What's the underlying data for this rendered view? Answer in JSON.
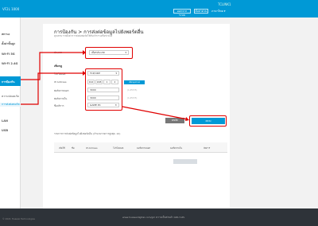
{
  "topbar": {
    "model": "VF2L 1000",
    "name": "TCLINK1",
    "btn_logout": "ออกจากระบบ",
    "btn_setup": "ตั้งค่าด่วน",
    "lang": "ภาษาไทย ▾"
  },
  "sidebar": {
    "items": [
      "สถานะ",
      "ตั้งค่าขั้นสูง",
      "Wi-Fi 5G",
      "Wi-Fi 2.4G",
      "การป้องกัน",
      "ความปลอดภัย",
      "การส่งต่อพอร์ต",
      "LAN",
      "USB"
    ],
    "active_sub": "การส่งต่อพอร์ต"
  },
  "page": {
    "title": "การป้องกัน > การส่งต่อข้อมูลไปยังพอร์ตอื่น",
    "subtitle": "คุณสามารถตั้งค่าการส่งต่อพอร์ตให้กับบริการเครือข่ายได้"
  },
  "form": {
    "type_label": "ประเภท",
    "type_value": "เลือกประเภท",
    "rule_title": "เพิ่มกฎ",
    "protocol_label": "โปรโตคอล",
    "protocol_value": "TCP/UDP",
    "ip_label": "IP Address",
    "ip_parts": [
      "192",
      "168",
      "1",
      "2"
    ],
    "ip_badge": "เลือกอุปกรณ์",
    "ext_port_label": "พอร์ตภายนอก",
    "ext_port_value": "3000",
    "ext_port_hint": "(1-65535)",
    "int_port_label": "พอร์ตภายใน",
    "int_port_value": "3000",
    "int_port_hint": "(1-65535)",
    "app_label": "ชื่อบริการ",
    "app_value": "GAME PC",
    "cancel": "ยกเลิก",
    "ok": "ตกลง"
  },
  "list": {
    "title": "รายการการส่งต่อข้อมูลไปยังพอร์ตอื่น (จำนวนรายการสูงสุด: 10)",
    "headers": [
      "เปิดใช้",
      "ชื่อ",
      "IP Address",
      "โปรโตคอล",
      "พอร์ตภายนอก",
      "พอร์ตภายใน",
      "จัดการ"
    ]
  },
  "footer": {
    "copy": "© 2021 Huawei Technologies",
    "links": "www.huaweidigital.com/gm   ความเป็นส่วนตัว   GNU GPL"
  },
  "colors": {
    "accent": "#0099d6",
    "highlight": "#e00000"
  }
}
